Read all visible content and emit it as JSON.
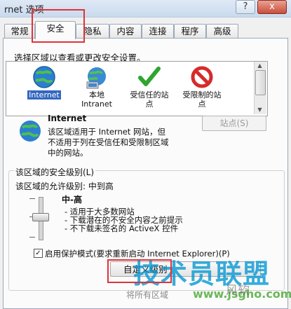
{
  "window": {
    "title": "rnet 选项",
    "help": "?",
    "close": "x"
  },
  "tabs": [
    "常规",
    "安全",
    "隐私",
    "内容",
    "连接",
    "程序",
    "高级"
  ],
  "instruction": "选择区域以查看或更改安全设置。",
  "zones": [
    {
      "line1": "Internet",
      "line2": "",
      "icon": "globe-icon",
      "selected": true
    },
    {
      "line1": "本地",
      "line2": "Intranet",
      "icon": "intranet-globe-icon",
      "selected": false
    },
    {
      "line1": "受信任的站",
      "line2": "点",
      "icon": "green-check-icon",
      "selected": false
    },
    {
      "line1": "受限制的站",
      "line2": "点",
      "icon": "forbidden-icon",
      "selected": false
    }
  ],
  "zone_info": {
    "name": "Internet",
    "desc1": "该区域适用于 Internet 网站，但",
    "desc2": "不适用于列在受信任和受限制区域",
    "desc3": "中的网站。"
  },
  "sites_button": "站点(S)",
  "security_level": {
    "group_title": "该区域的安全级别(L)",
    "allowed": "该区域的允许级别: 中到高",
    "level": "中-高",
    "bullet1": "- 适用于大多数网站",
    "bullet2": "- 下载潜在的不安全内容之前提示",
    "bullet3": "- 不下载未签名的 ActiveX 控件"
  },
  "protected_mode": {
    "label": "启用保护模式(要求重新启动 Internet Explorer)(P)",
    "checked": true
  },
  "custom_button": "自定义级别",
  "bottom_text": "将所有区域",
  "watermark": {
    "big": "技术员联盟",
    "url": "www.jsgho.com",
    "corner": "风软"
  },
  "colors": {
    "highlight": "#3367c0",
    "red_annotation": "#e0323a",
    "watermark_blue": "#0096d2"
  }
}
